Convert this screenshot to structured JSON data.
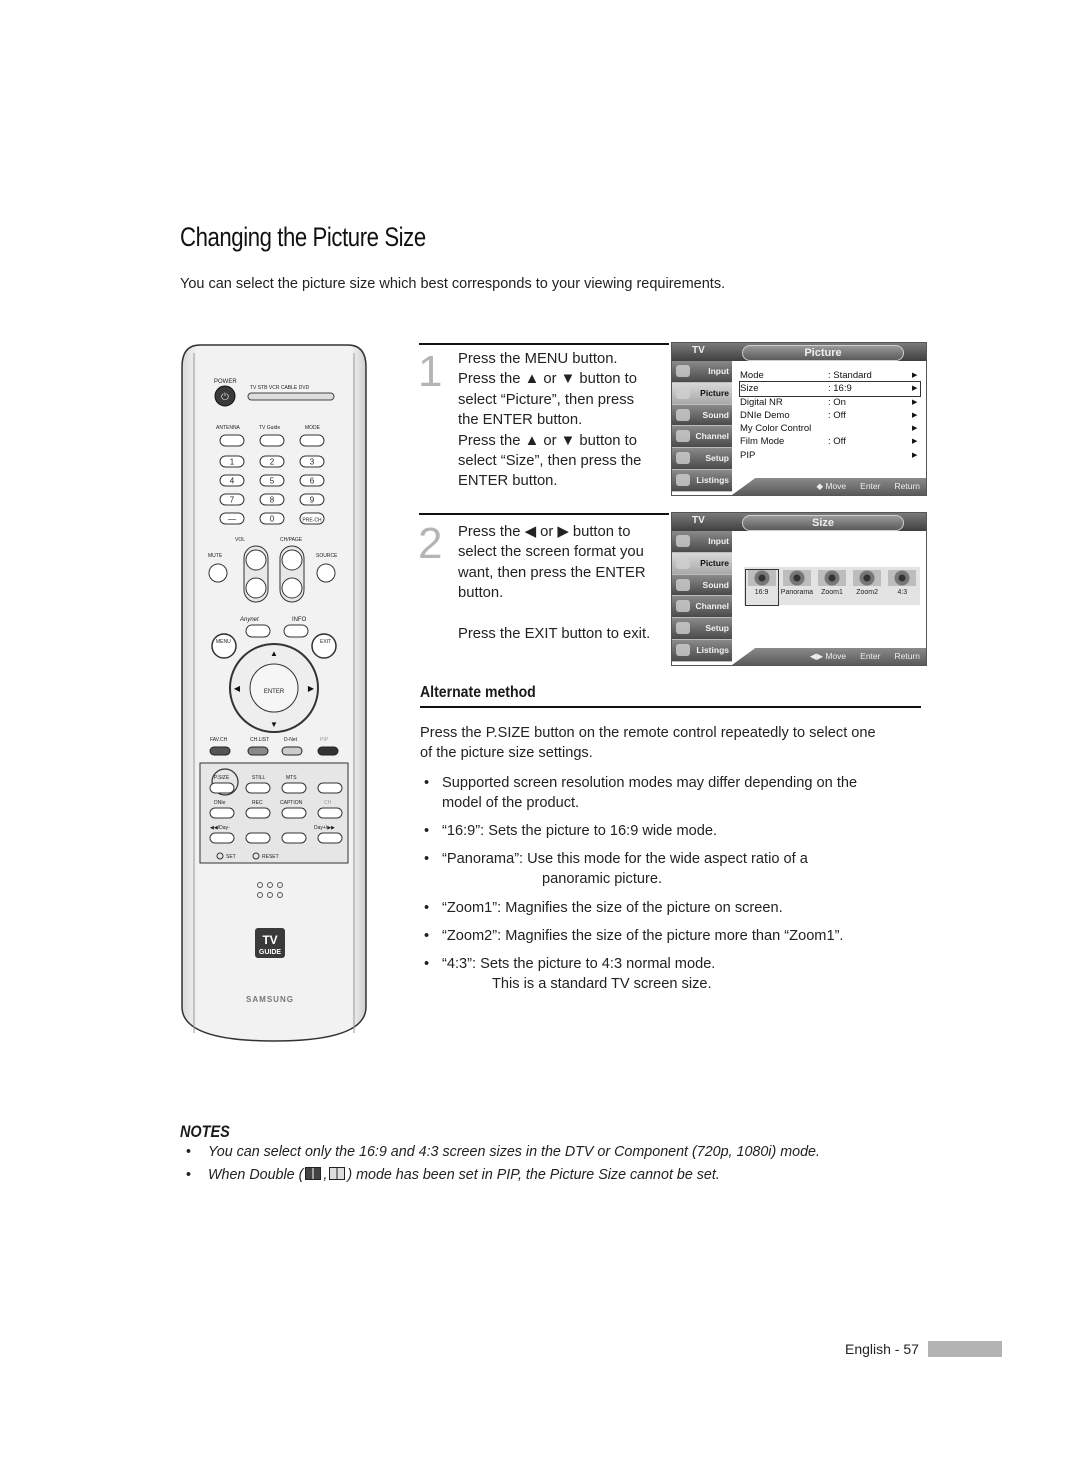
{
  "page": {
    "title": "Changing the Picture Size",
    "intro": "You can select the picture size which best corresponds to your viewing requirements."
  },
  "steps": [
    {
      "number": "1",
      "lines": [
        "Press the MENU button.",
        "Press the ▲ or ▼ button to",
        "select “Picture”, then press",
        "the ENTER button.",
        "Press the ▲ or ▼ button to",
        "select “Size”, then press the",
        "ENTER button."
      ]
    },
    {
      "number": "2",
      "lines": [
        "Press the ◀ or ▶ button to",
        "select the screen format you",
        "want, then press the ENTER",
        "button."
      ],
      "extra": "Press the EXIT button to exit."
    }
  ],
  "tv_menu_picture": {
    "tv_label": "TV",
    "header": "Picture",
    "sidebar": [
      "Input",
      "Picture",
      "Sound",
      "Channel",
      "Setup",
      "Listings"
    ],
    "selected_sidebar": "Picture",
    "rows": [
      {
        "label": "Mode",
        "value": ": Standard"
      },
      {
        "label": "Size",
        "value": ": 16:9",
        "selected": true
      },
      {
        "label": "Digital NR",
        "value": ": On"
      },
      {
        "label": "DNIe Demo",
        "value": ": Off"
      },
      {
        "label": "My Color Control",
        "value": ""
      },
      {
        "label": "Film Mode",
        "value": ": Off"
      },
      {
        "label": "PIP",
        "value": ""
      }
    ],
    "footer": {
      "move": "◆ Move",
      "enter": "Enter",
      "return": "Return"
    }
  },
  "tv_menu_size": {
    "tv_label": "TV",
    "header": "Size",
    "sidebar": [
      "Input",
      "Picture",
      "Sound",
      "Channel",
      "Setup",
      "Listings"
    ],
    "selected_sidebar": "Picture",
    "options": [
      "16:9",
      "Panorama",
      "Zoom1",
      "Zoom2",
      "4:3"
    ],
    "selected_option": "16:9",
    "footer": {
      "move": "◀▶ Move",
      "enter": "Enter",
      "return": "Return"
    }
  },
  "remote": {
    "power": "POWER",
    "modes": "TV  STB  VCR  CABLE  DVD",
    "top_buttons": [
      "ANTENNA",
      "TV Guide",
      "MODE"
    ],
    "digits": [
      "1",
      "2",
      "3",
      "4",
      "5",
      "6",
      "7",
      "8",
      "9",
      "—",
      "0",
      "PRE-CH"
    ],
    "vol": "VOL",
    "chpage": "CH/PAGE",
    "mute": "MUTE",
    "source": "SOURCE",
    "anynet": "Anynet",
    "info": "INFO",
    "menu": "MENU",
    "exit": "EXIT",
    "enter": "ENTER",
    "color_buttons": [
      "FAV.CH",
      "CH.LIST",
      "D-Net",
      "PIP"
    ],
    "lower": [
      "P.SIZE",
      "STILL",
      "MTS",
      "DNIe",
      "REC",
      "CAPTION",
      "CH"
    ],
    "day_minus": "◀◀/Day-",
    "day_plus": "Day+/▶▶",
    "set": "SET",
    "reset": "RESET",
    "tvguide_top": "TV",
    "tvguide_bottom": "GUIDE",
    "brand": "SAMSUNG"
  },
  "alternate": {
    "title": "Alternate method",
    "body_lines": [
      "Press the P.SIZE button on the remote control repeatedly to select one",
      "of the picture size settings."
    ],
    "bullets": [
      {
        "lines": [
          "Supported screen resolution modes may differ depending on the",
          "model of the product."
        ]
      },
      {
        "lines": [
          "“16:9”: Sets the picture to 16:9 wide mode."
        ]
      },
      {
        "lines": [
          "“Panorama”: Use this mode for the wide aspect ratio of a",
          "panoramic picture."
        ]
      },
      {
        "lines": [
          "“Zoom1”: Magnifies the size of the picture on screen."
        ]
      },
      {
        "lines": [
          "“Zoom2”: Magnifies the size of the picture more than “Zoom1”."
        ]
      },
      {
        "lines": [
          "“4:3”: Sets the picture to 4:3 normal mode.",
          "This is a standard TV screen size."
        ]
      }
    ]
  },
  "notes": {
    "title": "NOTES",
    "items": [
      "You can select only the 16:9 and 4:3 screen sizes in the DTV or Component (720p, 1080i) mode.",
      {
        "before": "When Double (",
        "sep": ",",
        "after": ") mode has been set in PIP, the Picture Size cannot be set."
      }
    ]
  },
  "footer": {
    "page_label": "English - 57"
  }
}
